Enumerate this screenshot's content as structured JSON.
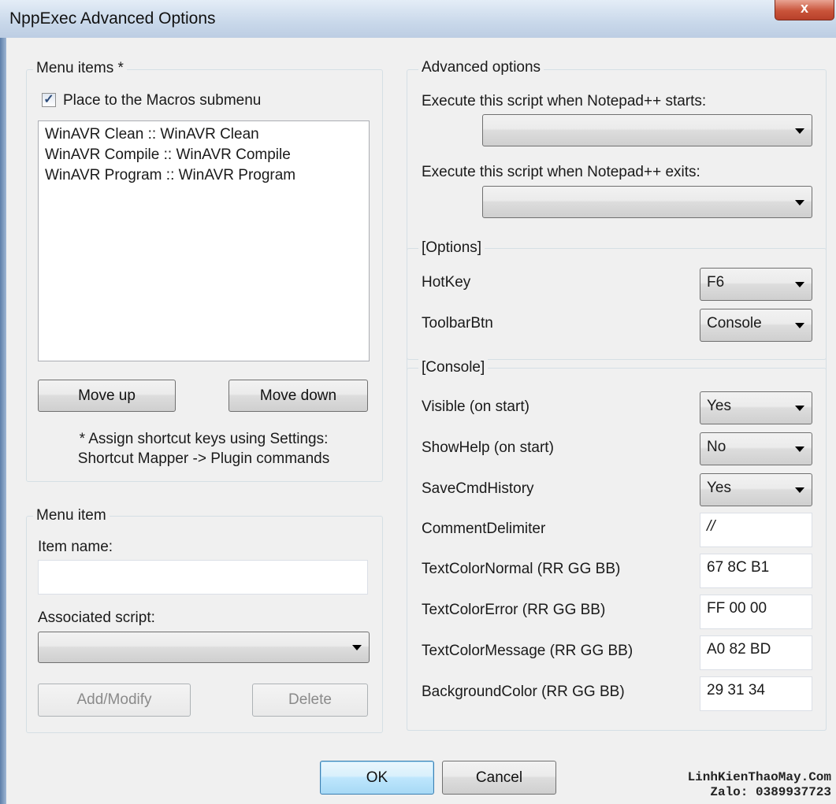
{
  "window": {
    "title": "NppExec Advanced Options",
    "close_glyph": "x"
  },
  "menu_items_group": {
    "label": "Menu items *",
    "checkbox_label": "Place to the Macros submenu",
    "checkbox_checked": true,
    "list": [
      "WinAVR Clean :: WinAVR Clean",
      "WinAVR Compile :: WinAVR Compile",
      "WinAVR Program :: WinAVR Program"
    ],
    "move_up": "Move up",
    "move_down": "Move down",
    "note_line1": "* Assign shortcut keys using Settings:",
    "note_line2": "Shortcut Mapper -> Plugin commands"
  },
  "menu_item_group": {
    "label": "Menu item",
    "item_name_label": "Item name:",
    "item_name_value": "",
    "associated_script_label": "Associated script:",
    "associated_script_value": "",
    "add_modify": "Add/Modify",
    "delete": "Delete"
  },
  "advanced": {
    "label": "Advanced options",
    "start_label": "Execute this script when Notepad++ starts:",
    "start_value": "",
    "exit_label": "Execute this script when Notepad++ exits:",
    "exit_value": ""
  },
  "options": {
    "label": "[Options]",
    "hotkey_label": "HotKey",
    "hotkey_value": "F6",
    "toolbarbtn_label": "ToolbarBtn",
    "toolbarbtn_value": "Console"
  },
  "console": {
    "label": "[Console]",
    "visible_label": "Visible (on start)",
    "visible_value": "Yes",
    "showhelp_label": "ShowHelp (on start)",
    "showhelp_value": "No",
    "savecmd_label": "SaveCmdHistory",
    "savecmd_value": "Yes",
    "comment_label": "CommentDelimiter",
    "comment_value": "//",
    "normal_label": "TextColorNormal (RR GG BB)",
    "normal_value": "67 8C B1",
    "error_label": "TextColorError (RR GG BB)",
    "error_value": "FF 00 00",
    "message_label": "TextColorMessage (RR GG BB)",
    "message_value": "A0 82 BD",
    "bg_label": "BackgroundColor (RR GG BB)",
    "bg_value": "29 31 34"
  },
  "footer": {
    "ok": "OK",
    "cancel": "Cancel"
  },
  "watermark": {
    "line1": "LinhKienThaoMay.Com",
    "line2": "Zalo: 0389937723"
  }
}
